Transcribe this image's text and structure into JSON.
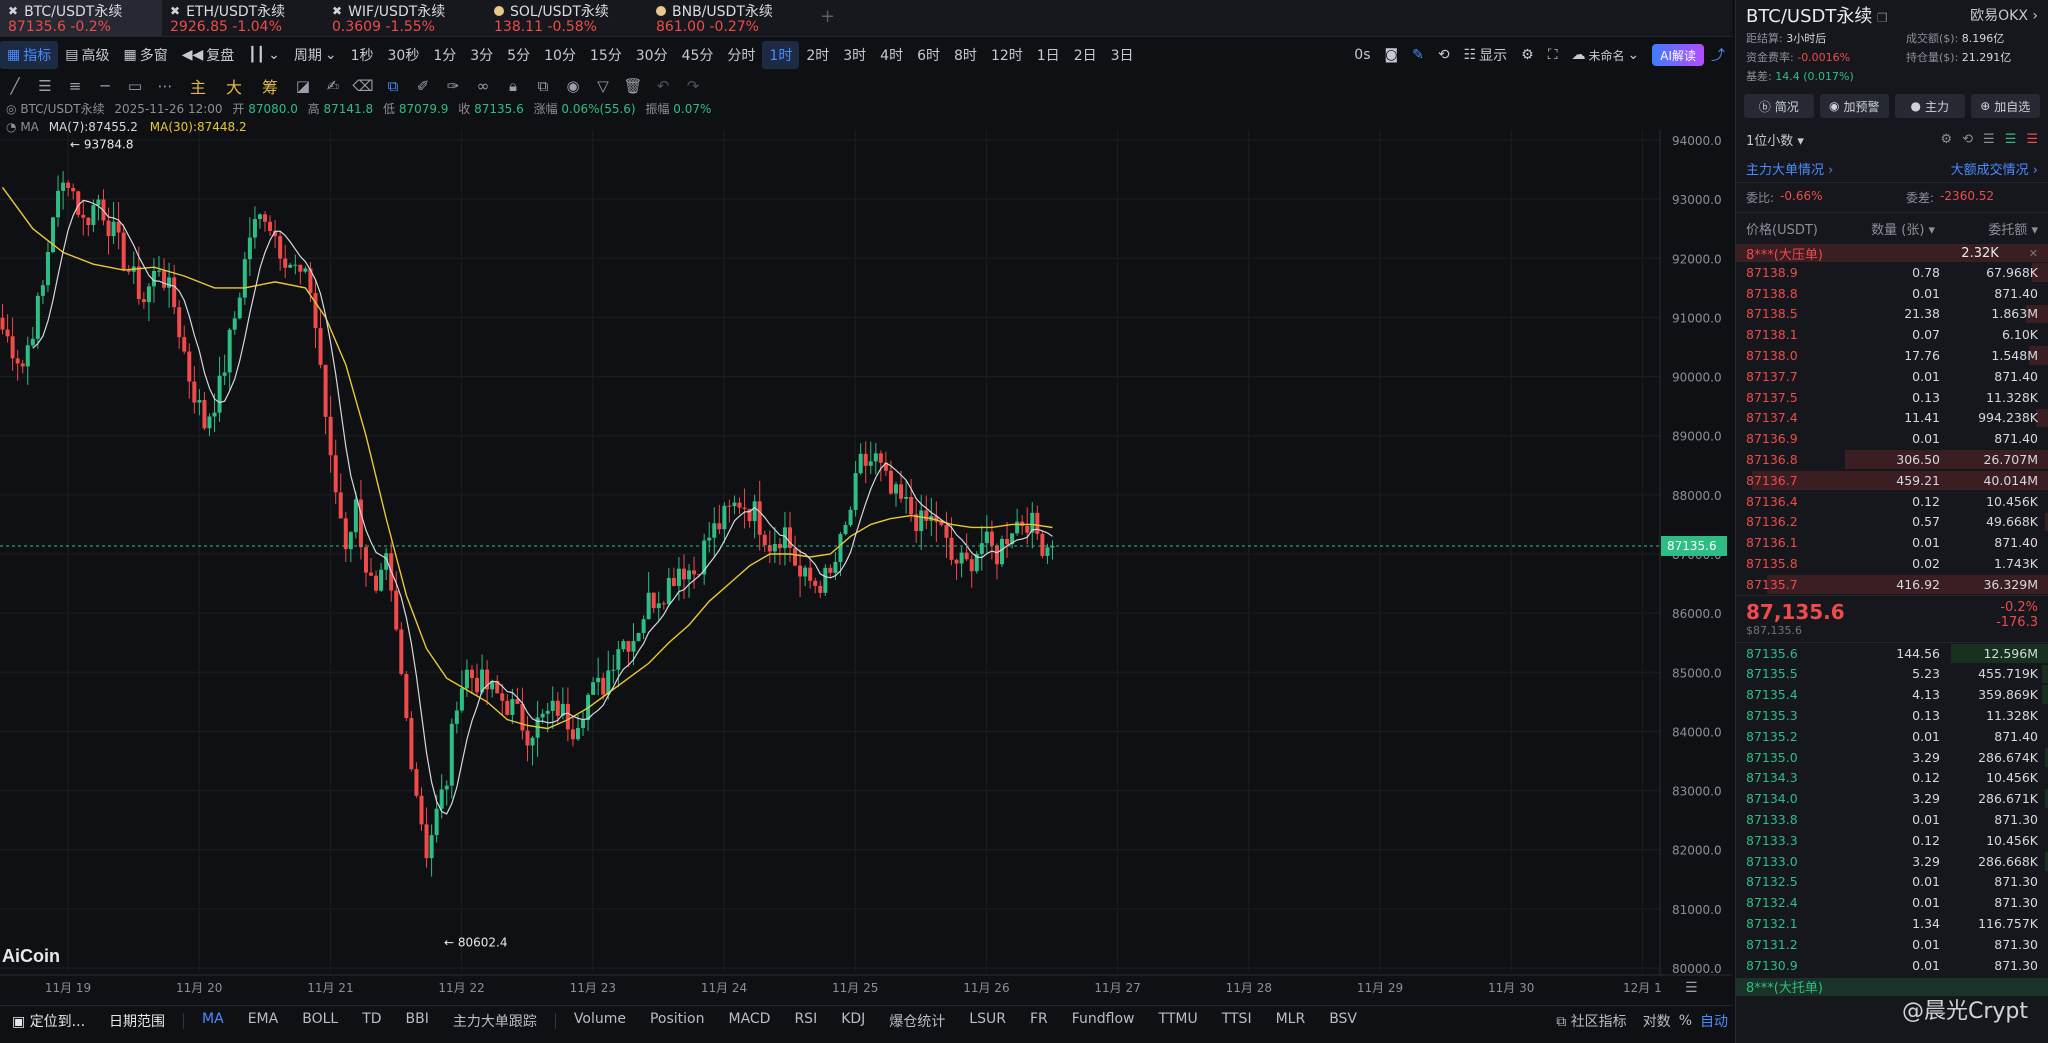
{
  "tabs": [
    {
      "name": "BTC/USDT永续",
      "price": "87135.6",
      "change": "-0.2%",
      "icon": "close-x-icon"
    },
    {
      "name": "ETH/USDT永续",
      "price": "2926.85",
      "change": "-1.04%",
      "icon": "close-x-icon"
    },
    {
      "name": "WIF/USDT永续",
      "price": "0.3609",
      "change": "-1.55%",
      "icon": "close-x-icon"
    },
    {
      "name": "SOL/USDT永续",
      "price": "138.11",
      "change": "-0.58%",
      "icon": "dot-icon"
    },
    {
      "name": "BNB/USDT永续",
      "price": "861.00",
      "change": "-0.27%",
      "icon": "dot-icon"
    }
  ],
  "tab_add": "+",
  "toolbar": {
    "indicators": "指标",
    "advanced": "高级",
    "multi": "多窗",
    "review": "复盘",
    "period": "周期",
    "intervals": [
      "1秒",
      "30秒",
      "1分",
      "3分",
      "5分",
      "10分",
      "15分",
      "30分",
      "45分",
      "分时",
      "1时",
      "2时",
      "3时",
      "4时",
      "6时",
      "8时",
      "12时",
      "1日",
      "2日",
      "3日"
    ],
    "active_interval": "1时",
    "countdown": "0s",
    "display": "显示",
    "unnamed": "未命名",
    "ai": "AI解读"
  },
  "drawbar": {
    "main": "主",
    "big": "大",
    "chips": "筹"
  },
  "info": {
    "symbol": "BTC/USDT永续",
    "datetime": "2025-11-26 12:00",
    "open_label": "开",
    "open": "87080.0",
    "high_label": "高",
    "high": "87141.8",
    "low_label": "低",
    "low": "87079.9",
    "close_label": "收",
    "close": "87135.6",
    "change_label": "涨幅",
    "change": "0.06%(55.6)",
    "amp_label": "振幅",
    "amp": "0.07%"
  },
  "ma": {
    "label": "MA",
    "ma7": "MA(7):87455.2",
    "ma30": "MA(30):87448.2"
  },
  "chart_data": {
    "type": "candlestick",
    "symbol": "BTC/USDT永续",
    "interval": "1时",
    "y_ticks": [
      "94000.0",
      "93000.0",
      "92000.0",
      "91000.0",
      "90000.0",
      "89000.0",
      "88000.0",
      "87000.0",
      "86000.0",
      "85000.0",
      "84000.0",
      "83000.0",
      "82000.0",
      "81000.0",
      "80000.0"
    ],
    "ylim": [
      80000,
      94000
    ],
    "x_ticks": [
      "11月 19",
      "11月 20",
      "11月 21",
      "11月 22",
      "11月 23",
      "11月 24",
      "11月 25",
      "11月 26",
      "11月 27",
      "11月 28",
      "11月 29",
      "11月 30",
      "12月 1"
    ],
    "high_marker": "93784.8",
    "low_marker": "80602.4",
    "last_price": "87135.6",
    "close_path": [
      [
        0,
        90800
      ],
      [
        4,
        90200
      ],
      [
        8,
        91500
      ],
      [
        10,
        92800
      ],
      [
        13,
        93400
      ],
      [
        16,
        92600
      ],
      [
        19,
        93000
      ],
      [
        22,
        92400
      ],
      [
        25,
        91800
      ],
      [
        28,
        91300
      ],
      [
        31,
        91900
      ],
      [
        34,
        91200
      ],
      [
        37,
        90000
      ],
      [
        40,
        89200
      ],
      [
        43,
        89800
      ],
      [
        46,
        91000
      ],
      [
        49,
        92400
      ],
      [
        52,
        92800
      ],
      [
        55,
        92200
      ],
      [
        58,
        91800
      ],
      [
        61,
        91500
      ],
      [
        63,
        90200
      ],
      [
        65,
        88500
      ],
      [
        68,
        87200
      ],
      [
        70,
        87800
      ],
      [
        72,
        86800
      ],
      [
        74,
        86200
      ],
      [
        76,
        86800
      ],
      [
        78,
        85600
      ],
      [
        80,
        84200
      ],
      [
        82,
        83000
      ],
      [
        84,
        82000
      ],
      [
        86,
        82600
      ],
      [
        88,
        83200
      ],
      [
        90,
        84600
      ],
      [
        92,
        85000
      ],
      [
        95,
        84800
      ],
      [
        98,
        84600
      ],
      [
        101,
        84400
      ],
      [
        104,
        84000
      ],
      [
        107,
        84200
      ],
      [
        110,
        84400
      ],
      [
        113,
        84100
      ],
      [
        116,
        84600
      ],
      [
        119,
        84800
      ],
      [
        122,
        85500
      ],
      [
        125,
        85600
      ],
      [
        128,
        86200
      ],
      [
        131,
        86400
      ],
      [
        134,
        86800
      ],
      [
        137,
        86700
      ],
      [
        140,
        87300
      ],
      [
        143,
        87600
      ],
      [
        146,
        87900
      ],
      [
        149,
        87700
      ],
      [
        152,
        87200
      ],
      [
        155,
        87400
      ],
      [
        158,
        86600
      ],
      [
        161,
        86500
      ],
      [
        164,
        86600
      ],
      [
        167,
        87400
      ],
      [
        170,
        88500
      ],
      [
        173,
        88600
      ],
      [
        176,
        88000
      ],
      [
        179,
        87800
      ],
      [
        182,
        87500
      ],
      [
        185,
        87600
      ],
      [
        188,
        86900
      ],
      [
        191,
        86800
      ],
      [
        194,
        87200
      ],
      [
        197,
        87000
      ],
      [
        200,
        87500
      ],
      [
        203,
        87600
      ],
      [
        206,
        87200
      ],
      [
        208,
        87135.6
      ]
    ],
    "ma30_path": [
      [
        0,
        93200
      ],
      [
        6,
        92500
      ],
      [
        12,
        92100
      ],
      [
        18,
        91900
      ],
      [
        24,
        91800
      ],
      [
        30,
        91850
      ],
      [
        36,
        91700
      ],
      [
        42,
        91500
      ],
      [
        48,
        91500
      ],
      [
        54,
        91600
      ],
      [
        60,
        91500
      ],
      [
        64,
        91000
      ],
      [
        68,
        90200
      ],
      [
        72,
        89000
      ],
      [
        76,
        87600
      ],
      [
        80,
        86300
      ],
      [
        84,
        85400
      ],
      [
        88,
        84900
      ],
      [
        92,
        84700
      ],
      [
        96,
        84500
      ],
      [
        100,
        84200
      ],
      [
        104,
        84100
      ],
      [
        108,
        84050
      ],
      [
        112,
        84200
      ],
      [
        116,
        84400
      ],
      [
        120,
        84650
      ],
      [
        124,
        84900
      ],
      [
        128,
        85150
      ],
      [
        132,
        85500
      ],
      [
        136,
        85800
      ],
      [
        140,
        86200
      ],
      [
        144,
        86500
      ],
      [
        148,
        86800
      ],
      [
        152,
        87000
      ],
      [
        156,
        87000
      ],
      [
        160,
        86950
      ],
      [
        164,
        87000
      ],
      [
        168,
        87300
      ],
      [
        172,
        87500
      ],
      [
        176,
        87600
      ],
      [
        180,
        87650
      ],
      [
        184,
        87600
      ],
      [
        188,
        87500
      ],
      [
        192,
        87450
      ],
      [
        196,
        87450
      ],
      [
        200,
        87500
      ],
      [
        204,
        87500
      ],
      [
        208,
        87448.2
      ]
    ]
  },
  "watermark": "AiCoin",
  "bottom": {
    "locate": "定位到...",
    "daterange": "日期范围",
    "indicators": [
      "MA",
      "EMA",
      "BOLL",
      "TD",
      "BBI",
      "主力大单跟踪"
    ],
    "sub_indicators": [
      "Volume",
      "Position",
      "MACD",
      "RSI",
      "KDJ",
      "爆仓统计",
      "LSUR",
      "FR",
      "Fundflow",
      "TTMU",
      "TTSI",
      "MLR",
      "BSV"
    ],
    "community": "社区指标",
    "log": "对数",
    "pct": "%",
    "auto": "自动"
  },
  "orderbook": {
    "title": "BTC/USDT永续",
    "exchange": "欧易OKX",
    "settle_label": "距结算:",
    "settle": "3小时后",
    "volume_label": "成交额($):",
    "volume": "8.196亿",
    "funding_label": "资金费率:",
    "funding": "-0.0016%",
    "oi_label": "持仓量($):",
    "oi": "21.291亿",
    "basis_label": "基差:",
    "basis": "14.4 (0.017%)",
    "buttons": [
      "简况",
      "加预警",
      "主力",
      "加自选"
    ],
    "decimals": "1位小数",
    "big_orders": "主力大单情况",
    "big_trades": "大额成交情况",
    "ratio_label": "委比:",
    "ratio": "-0.66%",
    "diff_label": "委差:",
    "diff": "-2360.52",
    "col_price": "价格(USDT)",
    "col_qty": "数量 (张)",
    "col_amt": "委托额",
    "ask_banner": "8***(大压单)",
    "ask_banner_val": "2.32K",
    "bid_banner": "8***(大托单)",
    "asks": [
      {
        "p": "87138.9",
        "q": "0.78",
        "a": "67.968K",
        "w": 0.05
      },
      {
        "p": "87138.8",
        "q": "0.01",
        "a": "871.40",
        "w": 0.0
      },
      {
        "p": "87138.5",
        "q": "21.38",
        "a": "1.863M",
        "w": 0.07
      },
      {
        "p": "87138.1",
        "q": "0.07",
        "a": "6.10K",
        "w": 0.0
      },
      {
        "p": "87138.0",
        "q": "17.76",
        "a": "1.548M",
        "w": 0.06
      },
      {
        "p": "87137.7",
        "q": "0.01",
        "a": "871.40",
        "w": 0.0
      },
      {
        "p": "87137.5",
        "q": "0.13",
        "a": "11.328K",
        "w": 0.0
      },
      {
        "p": "87137.4",
        "q": "11.41",
        "a": "994.238K",
        "w": 0.04
      },
      {
        "p": "87136.9",
        "q": "0.01",
        "a": "871.40",
        "w": 0.0
      },
      {
        "p": "87136.8",
        "q": "306.50",
        "a": "26.707M",
        "w": 0.65
      },
      {
        "p": "87136.7",
        "q": "459.21",
        "a": "40.014M",
        "w": 0.95
      },
      {
        "p": "87136.4",
        "q": "0.12",
        "a": "10.456K",
        "w": 0.0
      },
      {
        "p": "87136.2",
        "q": "0.57",
        "a": "49.668K",
        "w": 0.01
      },
      {
        "p": "87136.1",
        "q": "0.01",
        "a": "871.40",
        "w": 0.0
      },
      {
        "p": "87135.8",
        "q": "0.02",
        "a": "1.743K",
        "w": 0.0
      },
      {
        "p": "87135.7",
        "q": "416.92",
        "a": "36.329M",
        "w": 0.9
      }
    ],
    "mid_price": "87,135.6",
    "mid_usd": "$87,135.6",
    "mid_pct": "-0.2%",
    "mid_chg": "-176.3",
    "bids": [
      {
        "p": "87135.6",
        "q": "144.56",
        "a": "12.596M",
        "w": 0.31
      },
      {
        "p": "87135.5",
        "q": "5.23",
        "a": "455.719K",
        "w": 0.02
      },
      {
        "p": "87135.4",
        "q": "4.13",
        "a": "359.869K",
        "w": 0.02
      },
      {
        "p": "87135.3",
        "q": "0.13",
        "a": "11.328K",
        "w": 0.0
      },
      {
        "p": "87135.2",
        "q": "0.01",
        "a": "871.40",
        "w": 0.0
      },
      {
        "p": "87135.0",
        "q": "3.29",
        "a": "286.674K",
        "w": 0.01
      },
      {
        "p": "87134.3",
        "q": "0.12",
        "a": "10.456K",
        "w": 0.0
      },
      {
        "p": "87134.0",
        "q": "3.29",
        "a": "286.671K",
        "w": 0.01
      },
      {
        "p": "87133.8",
        "q": "0.01",
        "a": "871.30",
        "w": 0.0
      },
      {
        "p": "87133.3",
        "q": "0.12",
        "a": "10.456K",
        "w": 0.0
      },
      {
        "p": "87133.0",
        "q": "3.29",
        "a": "286.668K",
        "w": 0.01
      },
      {
        "p": "87132.5",
        "q": "0.01",
        "a": "871.30",
        "w": 0.0
      },
      {
        "p": "87132.4",
        "q": "0.01",
        "a": "871.30",
        "w": 0.0
      },
      {
        "p": "87132.1",
        "q": "1.34",
        "a": "116.757K",
        "w": 0.0
      },
      {
        "p": "87131.2",
        "q": "0.01",
        "a": "871.30",
        "w": 0.0
      },
      {
        "p": "87130.9",
        "q": "0.01",
        "a": "871.30",
        "w": 0.0
      }
    ],
    "credit": "@晨光Crypt"
  },
  "colors": {
    "up": "#2ebd85",
    "down": "#f04a4a",
    "accent": "#4b8bff",
    "ma30": "#e8c834",
    "ma7": "#d6d8dd"
  }
}
